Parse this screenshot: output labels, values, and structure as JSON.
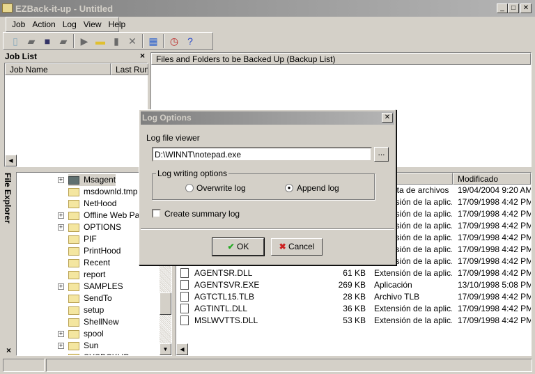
{
  "window": {
    "title": "EZBack-it-up - Untitled"
  },
  "menu": [
    "Job",
    "Action",
    "Log",
    "View",
    "Help"
  ],
  "toolbar": [
    "new-file-icon",
    "open-icon",
    "save-icon",
    "save-all-icon",
    "run-icon",
    "add-folder-icon",
    "add-file-icon",
    "delete-icon",
    "view-icon",
    "schedule-icon",
    "help-icon"
  ],
  "job_list": {
    "title": "Job List",
    "columns": [
      "Job Name",
      "Last Run"
    ]
  },
  "backup_list": {
    "title": "Files and Folders to be Backed Up (Backup List)"
  },
  "file_explorer": {
    "title": "File Explorer",
    "tree": [
      {
        "name": "Msagent",
        "expand": true
      },
      {
        "name": "msdownld.tmp"
      },
      {
        "name": "NetHood"
      },
      {
        "name": "Offline Web Pag",
        "expand": true
      },
      {
        "name": "OPTIONS",
        "expand": true
      },
      {
        "name": "PIF"
      },
      {
        "name": "PrintHood"
      },
      {
        "name": "Recent"
      },
      {
        "name": "report"
      },
      {
        "name": "SAMPLES",
        "expand": true
      },
      {
        "name": "SendTo"
      },
      {
        "name": "setup"
      },
      {
        "name": "ShellNew"
      },
      {
        "name": "spool",
        "expand": true
      },
      {
        "name": "Sun",
        "expand": true
      },
      {
        "name": "SYSBCKUP"
      }
    ],
    "columns": [
      "Modificado"
    ],
    "files": [
      {
        "name": "",
        "size": "",
        "type": "Carpeta de archivos",
        "modified": "19/04/2004 9:20 AM"
      },
      {
        "name": "",
        "size": "",
        "type": "Extensión de la aplic...",
        "modified": "17/09/1998 4:42 PM"
      },
      {
        "name": "",
        "size": "",
        "type": "Extensión de la aplic...",
        "modified": "17/09/1998 4:42 PM"
      },
      {
        "name": "",
        "size": "",
        "type": "Extensión de la aplic...",
        "modified": "17/09/1998 4:42 PM"
      },
      {
        "name": "",
        "size": "",
        "type": "Extensión de la aplic...",
        "modified": "17/09/1998 4:42 PM"
      },
      {
        "name": "",
        "size": "",
        "type": "Extensión de la aplic...",
        "modified": "17/09/1998 4:42 PM"
      },
      {
        "name": "",
        "size": "",
        "type": "Extensión de la aplic...",
        "modified": "17/09/1998 4:42 PM"
      },
      {
        "name": "AGENTSR.DLL",
        "size": "61 KB",
        "type": "Extensión de la aplic...",
        "modified": "17/09/1998 4:42 PM"
      },
      {
        "name": "AGENTSVR.EXE",
        "size": "269 KB",
        "type": "Aplicación",
        "modified": "13/10/1998 5:08 PM"
      },
      {
        "name": "AGTCTL15.TLB",
        "size": "28 KB",
        "type": "Archivo TLB",
        "modified": "17/09/1998 4:42 PM"
      },
      {
        "name": "AGTINTL.DLL",
        "size": "36 KB",
        "type": "Extensión de la aplic...",
        "modified": "17/09/1998 4:42 PM"
      },
      {
        "name": "MSLWVTTS.DLL",
        "size": "53 KB",
        "type": "Extensión de la aplic...",
        "modified": "17/09/1998 4:42 PM"
      }
    ]
  },
  "dialog": {
    "title": "Log Options",
    "viewer_label": "Log file viewer",
    "viewer_value": "D:\\WINNT\\notepad.exe",
    "browse": "...",
    "group": "Log writing options",
    "overwrite": "Overwrite log",
    "append": "Append log",
    "selected": "append",
    "summary": "Create summary log",
    "summary_checked": false,
    "ok": "OK",
    "cancel": "Cancel"
  }
}
